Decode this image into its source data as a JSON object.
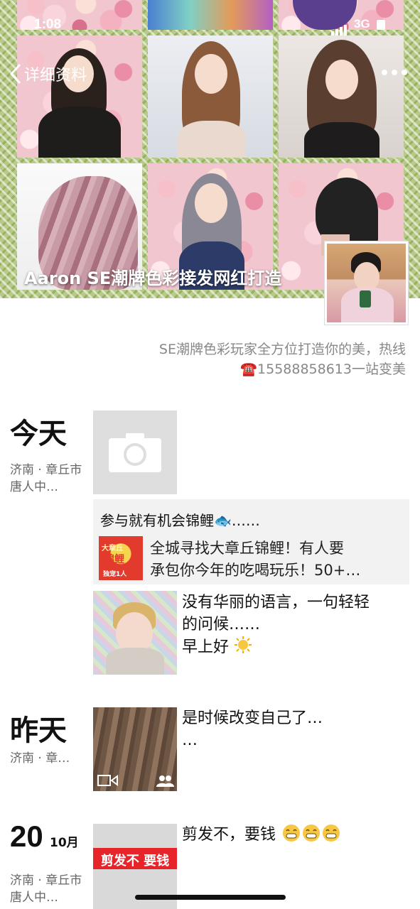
{
  "status": {
    "time": "1:08",
    "network": "3G"
  },
  "nav": {
    "back_label": "详细资料"
  },
  "cover": {
    "title": "Aaron SE潮牌色彩接发网红打造"
  },
  "profile": {
    "signature_line1": "SE潮牌色彩玩家全方位打造你的美，热线",
    "signature_line2": "☎️15588858613一站变美"
  },
  "feed": {
    "today": {
      "label": "今天",
      "location": "济南 · 章丘市唐人中…",
      "share_title": "参与就有机会锦鲤🐟……",
      "share_desc_line1": "全城寻找大章丘锦鲤！有人要",
      "share_desc_line2": "承包你今年的吃喝玩乐！50+…",
      "share_thumb_top": "大章丘",
      "share_thumb_mid": "锦鲤",
      "share_thumb_bottom": "独宠1人",
      "post_line1": "没有华丽的语言，一句轻轻",
      "post_line2": "的问候……",
      "post_line3": "早上好"
    },
    "yesterday": {
      "label": "昨天",
      "location": "济南 · 章…",
      "post_line1": "是时候改变自己了…",
      "post_line2": "…"
    },
    "oct20": {
      "day": "20",
      "month": "10月",
      "location": "济南 · 章丘市唐人中…",
      "post_text": "剪发不，要钱",
      "banner_text": "剪发不 要钱"
    }
  }
}
